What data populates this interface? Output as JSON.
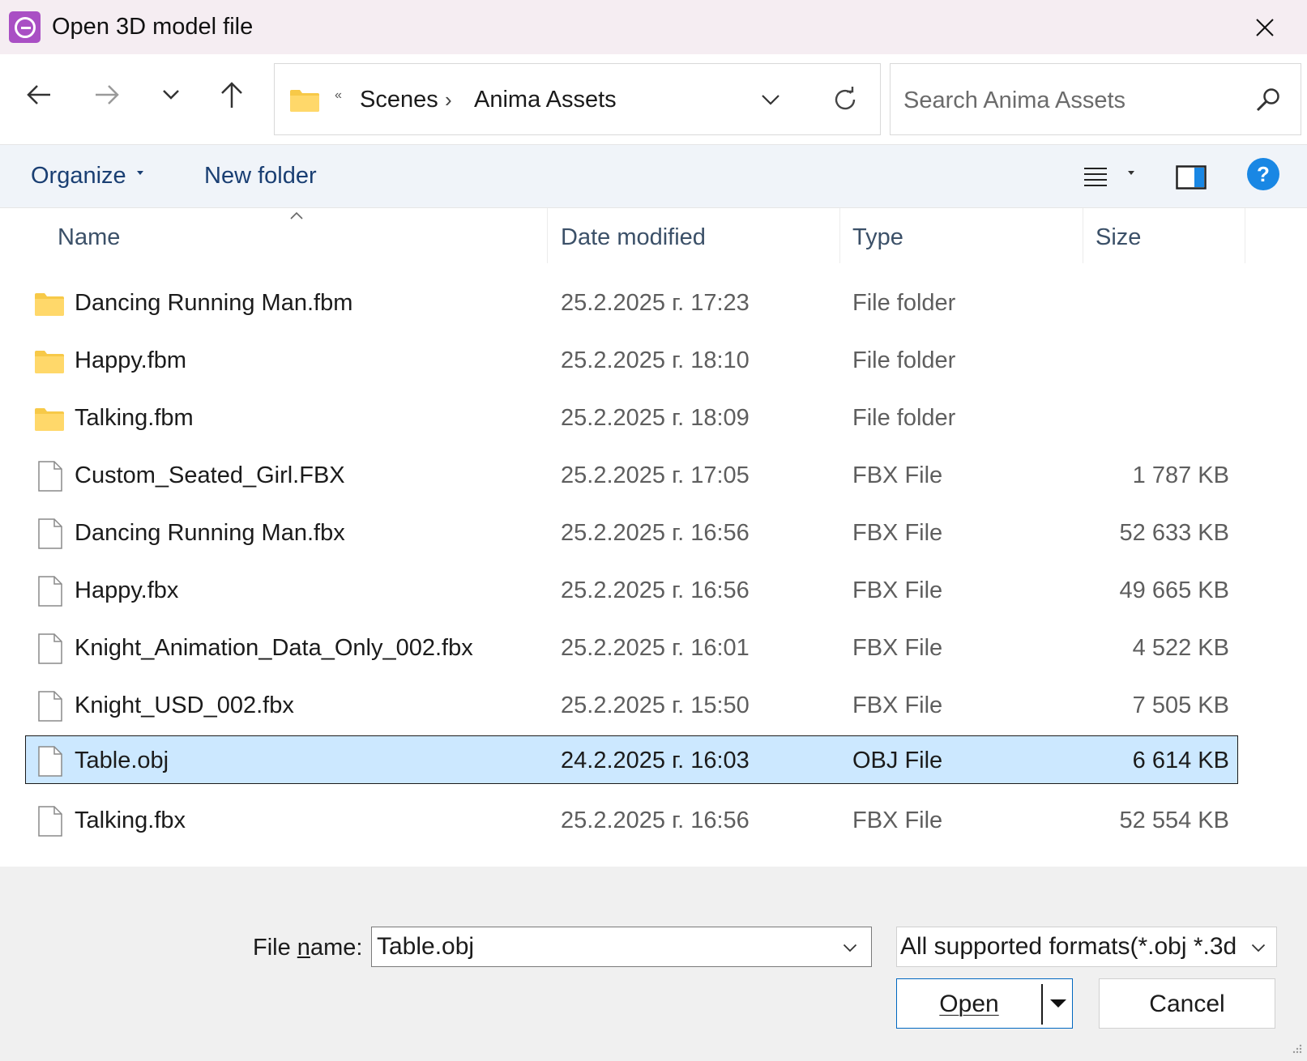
{
  "window": {
    "title": "Open 3D model file",
    "app_icon": "anima-logo-icon",
    "accent_color": "#a94fc4"
  },
  "nav": {
    "back_icon": "arrow-left-icon",
    "forward_icon": "arrow-right-icon",
    "recent_icon": "chevron-down-icon",
    "up_icon": "arrow-up-icon"
  },
  "address": {
    "overflow": "«",
    "crumbs": [
      "Scenes",
      "Anima Assets"
    ],
    "separator": "›"
  },
  "search": {
    "placeholder": "Search Anima Assets"
  },
  "commands": {
    "organize": "Organize",
    "new_folder": "New folder"
  },
  "columns": {
    "name": "Name",
    "date": "Date modified",
    "type": "Type",
    "size": "Size"
  },
  "files": [
    {
      "name": "Dancing Running Man.fbm",
      "date": "25.2.2025 г. 17:23",
      "type": "File folder",
      "size": "",
      "kind": "folder"
    },
    {
      "name": "Happy.fbm",
      "date": "25.2.2025 г. 18:10",
      "type": "File folder",
      "size": "",
      "kind": "folder"
    },
    {
      "name": "Talking.fbm",
      "date": "25.2.2025 г. 18:09",
      "type": "File folder",
      "size": "",
      "kind": "folder"
    },
    {
      "name": "Custom_Seated_Girl.FBX",
      "date": "25.2.2025 г. 17:05",
      "type": "FBX File",
      "size": "1 787 KB",
      "kind": "file"
    },
    {
      "name": "Dancing Running Man.fbx",
      "date": "25.2.2025 г. 16:56",
      "type": "FBX File",
      "size": "52 633 KB",
      "kind": "file"
    },
    {
      "name": "Happy.fbx",
      "date": "25.2.2025 г. 16:56",
      "type": "FBX File",
      "size": "49 665 KB",
      "kind": "file"
    },
    {
      "name": "Knight_Animation_Data_Only_002.fbx",
      "date": "25.2.2025 г. 16:01",
      "type": "FBX File",
      "size": "4 522 KB",
      "kind": "file"
    },
    {
      "name": "Knight_USD_002.fbx",
      "date": "25.2.2025 г. 15:50",
      "type": "FBX File",
      "size": "7 505 KB",
      "kind": "file"
    },
    {
      "name": "Table.obj",
      "date": "24.2.2025 г. 16:03",
      "type": "OBJ File",
      "size": "6 614 KB",
      "kind": "file",
      "selected": true
    },
    {
      "name": "Talking.fbx",
      "date": "25.2.2025 г. 16:56",
      "type": "FBX File",
      "size": "52 554 KB",
      "kind": "file"
    }
  ],
  "footer": {
    "file_name_label_pre": "File ",
    "file_name_label_key": "n",
    "file_name_label_post": "ame:",
    "file_name_value": "Table.obj",
    "file_type_value": "All supported formats(*.obj *.3d",
    "open_label_key": "O",
    "open_label_rest": "pen",
    "cancel_label": "Cancel"
  },
  "colors": {
    "selection": "#cce8ff",
    "command_text": "#1a3f73",
    "help": "#1987e4",
    "folder": "#f7c948"
  }
}
